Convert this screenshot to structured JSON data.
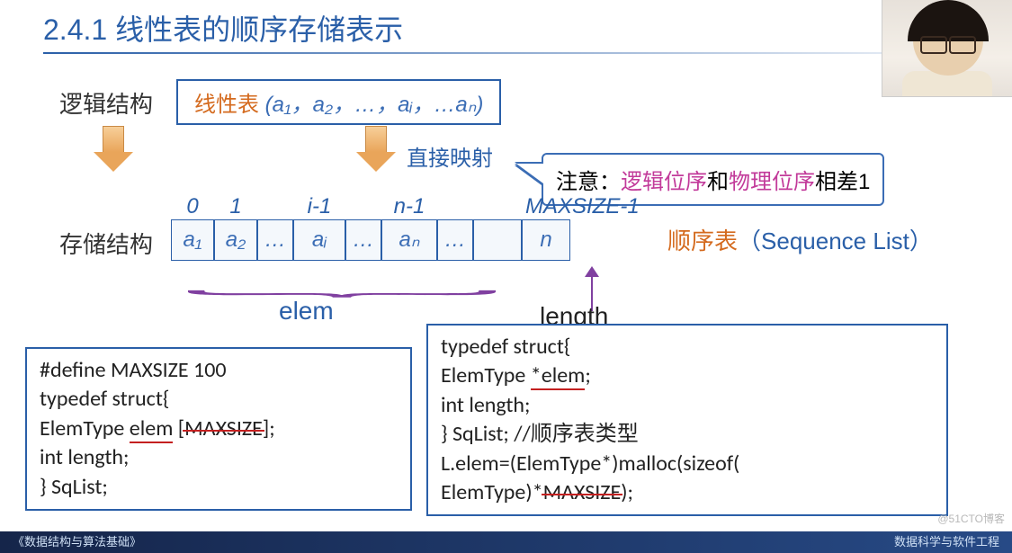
{
  "title": "2.4.1 线性表的顺序存储表示",
  "labels": {
    "logical": "逻辑结构",
    "storage": "存储结构",
    "mapping": "直接映射"
  },
  "linear_list": {
    "prefix": "线性表",
    "content": " (a₁，a₂，…，aᵢ，…aₙ)"
  },
  "notice": {
    "prefix": "注意：",
    "part1": "逻辑位序",
    "mid": "和",
    "part2": "物理位序",
    "suffix": "相差1"
  },
  "indices": [
    "0",
    "1",
    "",
    "i-1",
    "",
    "n-1",
    "",
    "",
    "MAXSIZE-1"
  ],
  "cells": [
    "a₁",
    "a₂",
    "…",
    "aᵢ",
    "…",
    "aₙ",
    "…",
    "",
    "n"
  ],
  "seq_label": {
    "cn": "顺序表",
    "paren_l": "（",
    "en": "Sequence List",
    "paren_r": "）"
  },
  "brace_labels": {
    "elem": "elem",
    "length": "length"
  },
  "code_left": {
    "l1": "#define MAXSIZE 100",
    "l2": "typedef struct{",
    "l3a": "  ElemType ",
    "l3b": "elem",
    "l3c": " [",
    "l3d": "MAXSIZE",
    "l3e": "];",
    "l4": "  int length;",
    "l5": "} SqList;"
  },
  "code_right": {
    "l1": "typedef struct{",
    "l2a": "  ElemType ",
    "l2b": "*elem",
    "l2c": ";",
    "l3": "  int length;",
    "l4": "} SqList;    //顺序表类型",
    "l5": "L.elem=(ElemType*)malloc(sizeof(",
    "l6a": "ElemType)*",
    "l6b": "MAXSIZE",
    "l6c": ");"
  },
  "footer": {
    "left": "《数据结构与算法基础》",
    "right": "数据科学与软件工程"
  },
  "watermark": "@51CTO博客",
  "chart_data": {
    "type": "diagram",
    "title": "线性表的顺序存储表示 (Sequential List Representation)",
    "logical_structure": "线性表 (a1, a2, …, ai, …, an)",
    "mapping": "直接映射 (direct mapping)",
    "storage_structure": {
      "array_name": "elem",
      "indices": [
        0,
        1,
        "…",
        "i-1",
        "…",
        "n-1",
        "…",
        "MAXSIZE-1"
      ],
      "contents": [
        "a1",
        "a2",
        "…",
        "ai",
        "…",
        "an",
        "…",
        "n"
      ],
      "length_field_stores": "n"
    },
    "note": "逻辑位序和物理位序相差1 (logical position and physical index differ by 1)",
    "c_definition_static": "#define MAXSIZE 100\ntypedef struct{\n  ElemType elem[MAXSIZE];\n  int length;\n} SqList;",
    "c_definition_dynamic": "typedef struct{\n  ElemType *elem;\n  int length;\n} SqList;  //顺序表类型\nL.elem=(ElemType*)malloc(sizeof(ElemType)*MAXSIZE);",
    "annotations": [
      "elem[MAXSIZE] struck out → replaced by *elem",
      "MAXSIZE in malloc struck out"
    ]
  }
}
